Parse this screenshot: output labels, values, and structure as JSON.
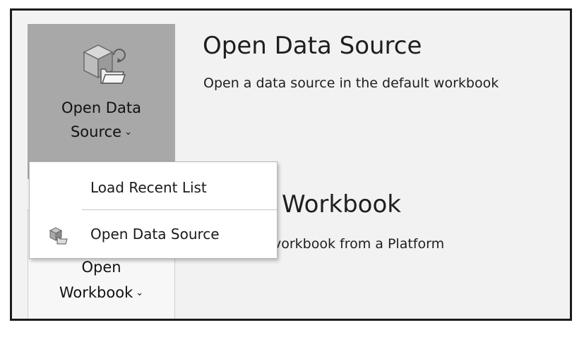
{
  "open_data_source_button": {
    "label_line1": "Open Data",
    "label_line2": "Source",
    "chevron": "⌄",
    "icon": "cube-open-folder-icon"
  },
  "open_data_source_section": {
    "title": "Open Data Source",
    "description": "Open a data source in the default workbook"
  },
  "open_workbook_section": {
    "title_visible": "Workbook",
    "description_visible": "vorkbook from a Platform"
  },
  "open_workbook_button": {
    "label_line1": "Open",
    "label_line2": "Workbook",
    "chevron": "⌄"
  },
  "dropdown_menu": {
    "items": [
      {
        "label": "Load Recent List",
        "icon": ""
      },
      {
        "label": "Open Data Source",
        "icon": "data-source-icon"
      }
    ]
  },
  "colors": {
    "pressed_button_bg": "#a8a8a8",
    "panel_bg": "#f2f2f2",
    "menu_bg": "#ffffff"
  }
}
